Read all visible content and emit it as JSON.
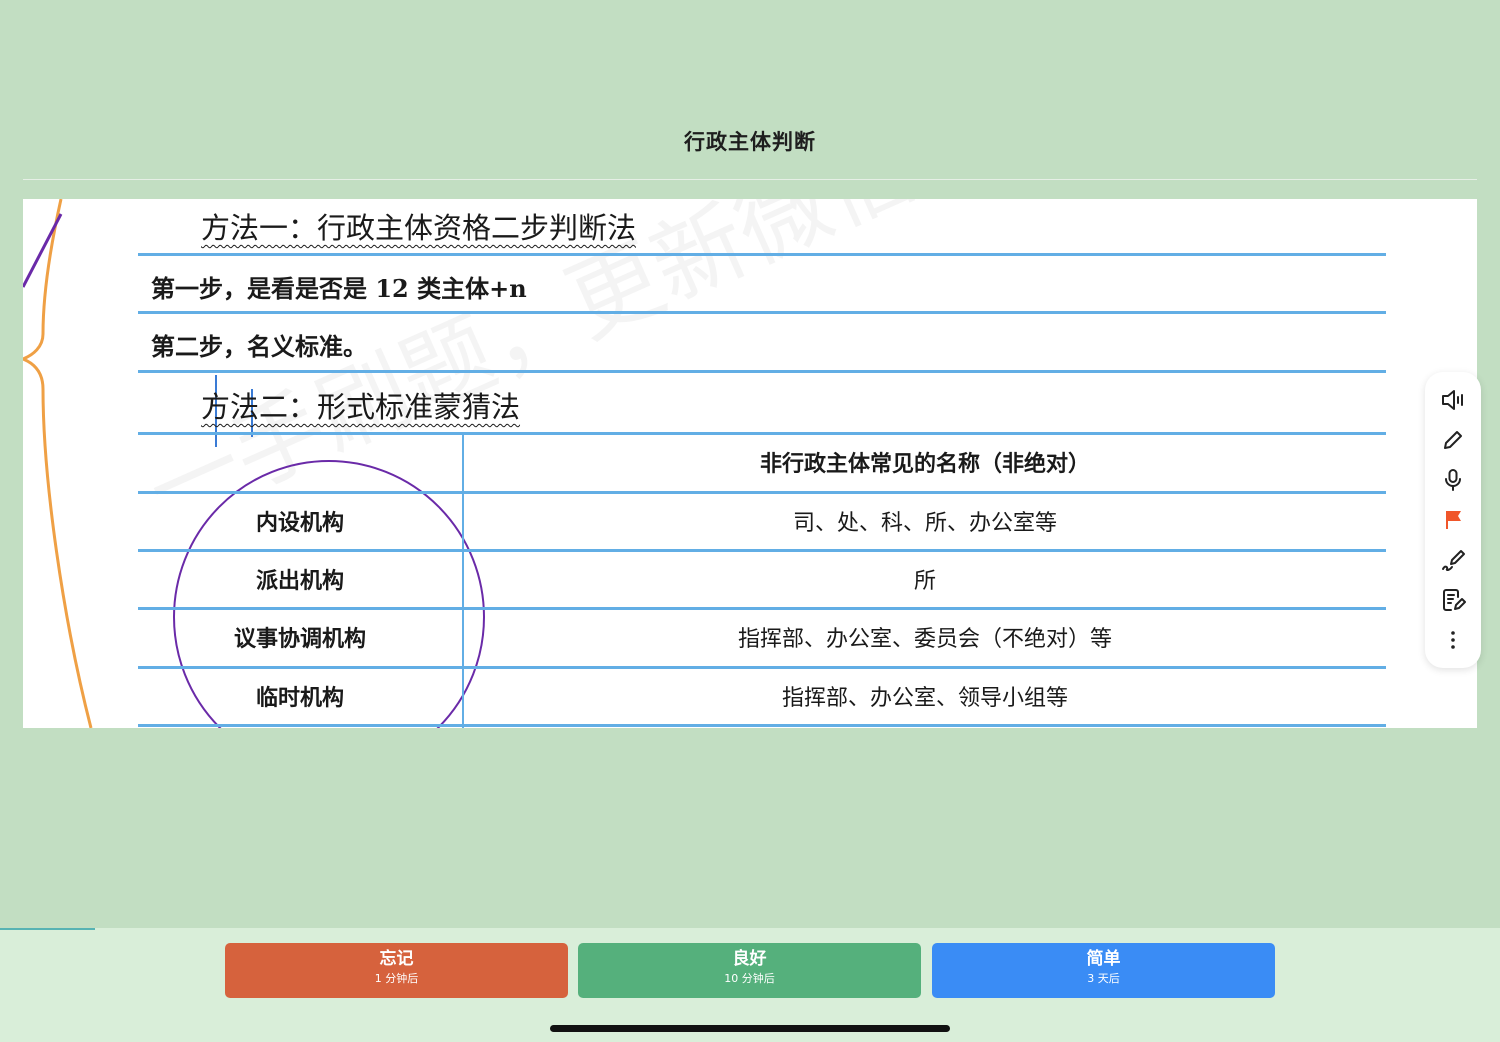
{
  "card": {
    "title": "行政主体判断"
  },
  "note": {
    "method1_heading": "方法一：行政主体资格二步判断法",
    "step1": "第一步，是看是否是 12 类主体+n",
    "step2": "第二步，名义标准。",
    "method2_heading": "方法二：形式标准蒙猜法",
    "table": {
      "header_right": "非行政主体常见的名称（非绝对）",
      "rows": [
        {
          "left": "内设机构",
          "right": "司、处、科、所、办公室等"
        },
        {
          "left": "派出机构",
          "right": "所"
        },
        {
          "left": "议事协调机构",
          "right": "指挥部、办公室、委员会（不绝对）等"
        },
        {
          "left": "临时机构",
          "right": "指挥部、办公室、领导小组等"
        }
      ]
    },
    "watermark": "一手刷题，更新微信：sikao"
  },
  "toolbar": {
    "icons": [
      "speaker-icon",
      "pencil-icon",
      "microphone-icon",
      "flag-icon",
      "draw-icon",
      "edit-note-icon",
      "more-vertical-icon"
    ],
    "flag_color": "#f0562a",
    "icon_color": "#222222"
  },
  "answers": {
    "again": {
      "label": "忘记",
      "interval": "1 分钟后",
      "color": "#d6623d"
    },
    "good": {
      "label": "良好",
      "interval": "10 分钟后",
      "color": "#55b07c"
    },
    "easy": {
      "label": "简单",
      "interval": "3 天后",
      "color": "#3a8cf5"
    }
  },
  "colors": {
    "background": "#c2dec2",
    "bottom_bar": "#d9eed9",
    "rule_blue": "#62aee5",
    "annotation_orange": "#efa045",
    "annotation_purple": "#6a2aa8"
  }
}
